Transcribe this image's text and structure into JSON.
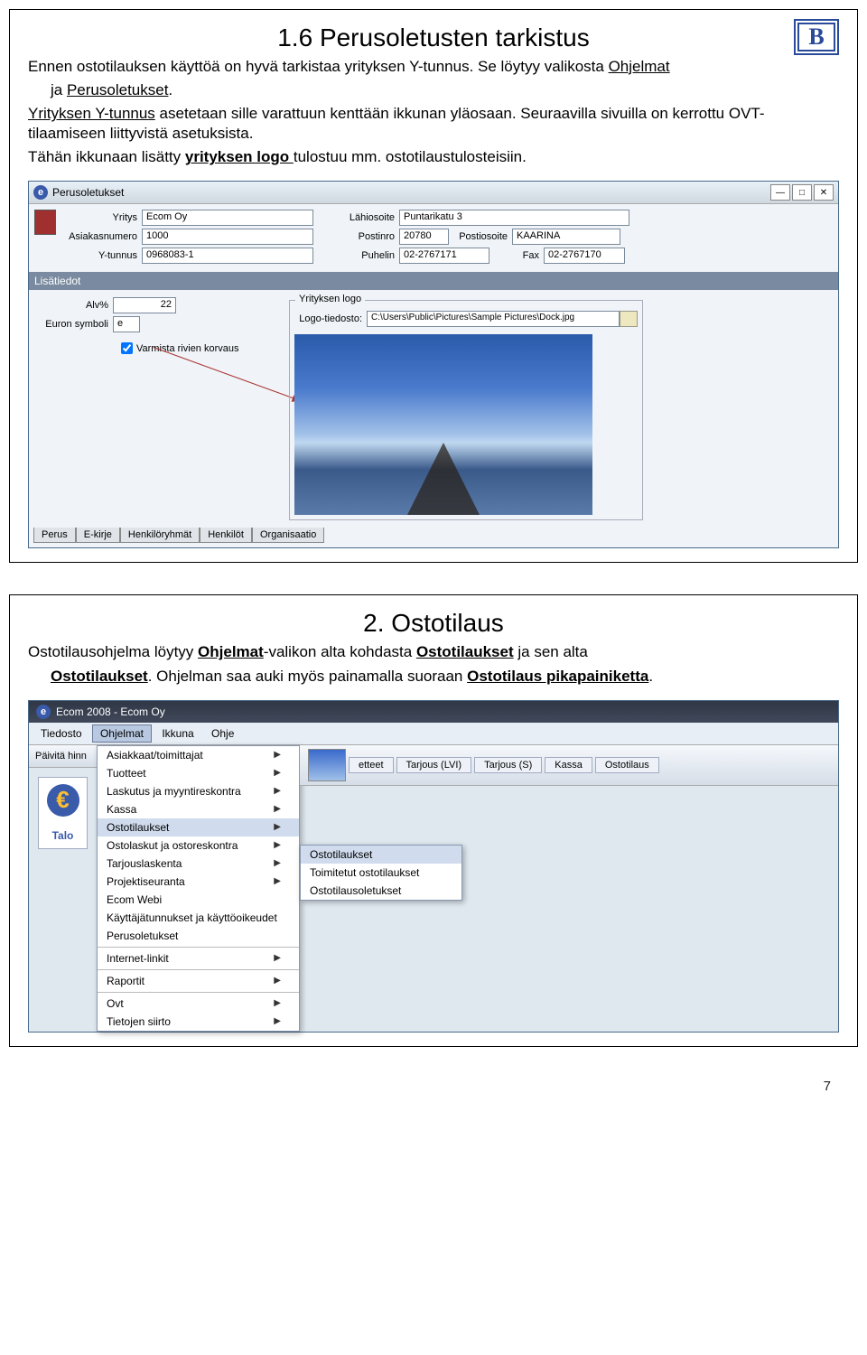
{
  "slide1": {
    "title": "1.6 Perusoletusten tarkistus",
    "logo": "B",
    "para1_a": "Ennen ostotilauksen käyttöä on hyvä tarkistaa yrityksen Y-tunnus. Se löytyy valikosta ",
    "para1_b": "Ohjelmat",
    "para1_c": "ja ",
    "para1_d": "Perusoletukset",
    "para2_a": "Yrityksen Y-tunnus",
    "para2_b": " asetetaan sille varattuun kenttään ikkunan yläosaan. Seuraavilla sivuilla on kerrottu OVT-tilaamiseen liittyvistä asetuksista.",
    "para3_a": "Tähän ikkunaan lisätty ",
    "para3_b": "yrityksen logo ",
    "para3_c": "tulostuu mm. ostotilaustulosteisiin.",
    "window": {
      "title": "Perusoletukset",
      "labels": {
        "yritys": "Yritys",
        "asiakasnumero": "Asiakasnumero",
        "ytunnus": "Y-tunnus",
        "lahiosoite": "Lähiosoite",
        "postinro": "Postinro",
        "postiosoite": "Postiosoite",
        "puhelin": "Puhelin",
        "fax": "Fax",
        "lisatiedot": "Lisätiedot",
        "alv": "Alv%",
        "euron": "Euron symboli",
        "varmista": "Varmista rivien korvaus",
        "logogroup": "Yrityksen logo",
        "logotiedosto": "Logo-tiedosto:"
      },
      "values": {
        "yritys": "Ecom Oy",
        "asiakasnumero": "1000",
        "ytunnus": "0968083-1",
        "lahiosoite": "Puntarikatu 3",
        "postinro": "20780",
        "postiosoite": "KAARINA",
        "puhelin": "02-2767171",
        "fax": "02-2767170",
        "alv": "22",
        "euron": "e",
        "logotiedosto": "C:\\Users\\Public\\Pictures\\Sample Pictures\\Dock.jpg"
      },
      "tabs": [
        "Perus",
        "E-kirje",
        "Henkilöryhmät",
        "Henkilöt",
        "Organisaatio"
      ]
    }
  },
  "slide2": {
    "title": "2. Ostotilaus",
    "para1_a": "Ostotilausohjelma löytyy ",
    "para1_b": "Ohjelmat",
    "para1_c": "-valikon alta kohdasta ",
    "para1_d": "Ostotilaukset",
    "para1_e": " ja sen alta ",
    "para1_f": "Ostotilaukset",
    "para1_g": ". Ohjelman saa auki myös painamalla suoraan ",
    "para1_h": "Ostotilaus pikapainiketta",
    "para1_i": ".",
    "app": {
      "title": "Ecom 2008 - Ecom Oy",
      "menubar": [
        "Tiedosto",
        "Ohjelmat",
        "Ikkuna",
        "Ohje"
      ],
      "toolbar_left": "Päivitä hinn",
      "toolbar_right": [
        "etteet",
        "Tarjous (LVI)",
        "Tarjous (S)",
        "Kassa",
        "Ostotilaus"
      ],
      "side_label": "Talo",
      "menu": [
        {
          "label": "Asiakkaat/toimittajat",
          "sub": true
        },
        {
          "label": "Tuotteet",
          "sub": true
        },
        {
          "label": "Laskutus ja myyntireskontra",
          "sub": true
        },
        {
          "label": "Kassa",
          "sub": true
        },
        {
          "label": "Ostotilaukset",
          "sub": true,
          "sel": true
        },
        {
          "label": "Ostolaskut ja ostoreskontra",
          "sub": true
        },
        {
          "label": "Tarjouslaskenta",
          "sub": true
        },
        {
          "label": "Projektiseuranta",
          "sub": true
        },
        {
          "label": "Ecom Webi",
          "sub": false
        },
        {
          "label": "Käyttäjätunnukset ja käyttöoikeudet",
          "sub": false
        },
        {
          "label": "Perusoletukset",
          "sub": false
        },
        {
          "sep": true
        },
        {
          "label": "Internet-linkit",
          "sub": true
        },
        {
          "sep": true
        },
        {
          "label": "Raportit",
          "sub": true
        },
        {
          "sep": true
        },
        {
          "label": "Ovt",
          "sub": true
        },
        {
          "label": "Tietojen siirto",
          "sub": true
        }
      ],
      "submenu": [
        "Ostotilaukset",
        "Toimitetut ostotilaukset",
        "Ostotilausoletukset"
      ]
    }
  },
  "page_number": "7"
}
